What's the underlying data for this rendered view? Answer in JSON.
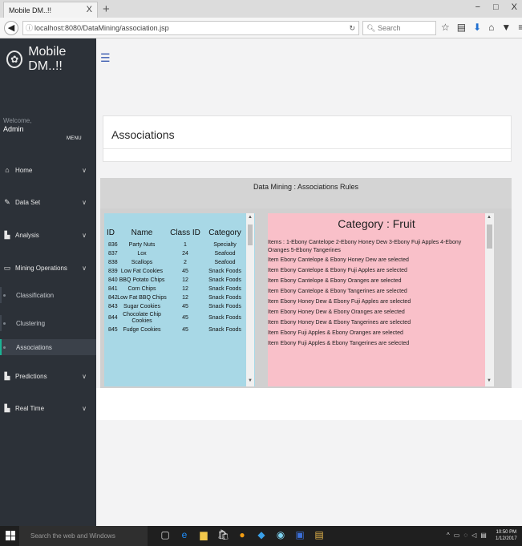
{
  "browser": {
    "tab_title": "Mobile DM..!!",
    "tab_close": "X",
    "new_tab": "+",
    "window_controls": [
      "−",
      "□",
      "X"
    ],
    "url": "localhost:8080/DataMining/association.jsp",
    "search_placeholder": "Search",
    "toolbar_icons": [
      "star-icon",
      "reader-icon",
      "download-icon",
      "home-icon",
      "pocket-icon",
      "menu-icon"
    ]
  },
  "sidebar": {
    "brand": "Mobile DM..!!",
    "welcome": "Welcome,",
    "user": "Admin",
    "menu_label": "MENU",
    "items": [
      {
        "label": "Home",
        "icon": "home-icon"
      },
      {
        "label": "Data Set",
        "icon": "edit-icon"
      },
      {
        "label": "Analysis",
        "icon": "chart-icon"
      },
      {
        "label": "Mining Operations",
        "icon": "monitor-icon"
      },
      {
        "label": "Predictions",
        "icon": "chart-icon"
      },
      {
        "label": "Real Time",
        "icon": "chart-icon"
      }
    ],
    "sub_items": [
      {
        "label": "Classification"
      },
      {
        "label": "Clustering"
      },
      {
        "label": "Associations",
        "active": true
      }
    ]
  },
  "main": {
    "page_title": "Associations",
    "rules_title": "Data Mining : Associations Rules",
    "products": {
      "headers": [
        "ID",
        "Name",
        "Class ID",
        "Category"
      ],
      "rows": [
        [
          "836",
          "Party Nuts",
          "1",
          "Specialty"
        ],
        [
          "837",
          "Lox",
          "24",
          "Seafood"
        ],
        [
          "838",
          "Scallops",
          "2",
          "Seafood"
        ],
        [
          "839",
          "Low Fat Cookies",
          "45",
          "Snack Foods"
        ],
        [
          "840",
          "BBQ Potato Chips",
          "12",
          "Snack Foods"
        ],
        [
          "841",
          "Corn Chips",
          "12",
          "Snack Foods"
        ],
        [
          "842",
          "Low Fat BBQ Chips",
          "12",
          "Snack Foods"
        ],
        [
          "843",
          "Sugar Cookies",
          "45",
          "Snack Foods"
        ],
        [
          "844",
          "Chocolate Chip Cookies",
          "45",
          "Snack Foods"
        ],
        [
          "845",
          "Fudge Cookies",
          "45",
          "Snack Foods"
        ]
      ]
    },
    "category": {
      "title": "Category : Fruit",
      "items_line": "Items : 1-Ebony Cantelope 2-Ebony Honey Dew 3-Ebony Fuji Apples 4-Ebony Oranges 5-Ebony Tangerines",
      "rules": [
        "Item Ebony Cantelope & Ebony Honey Dew are selected",
        "Item Ebony Cantelope & Ebony Fuji Apples are selected",
        "Item Ebony Cantelope & Ebony Oranges are selected",
        "Item Ebony Cantelope & Ebony Tangerines are selected",
        "Item Ebony Honey Dew & Ebony Fuji Apples are selected",
        "Item Ebony Honey Dew & Ebony Oranges are selected",
        "Item Ebony Honey Dew & Ebony Tangerines are selected",
        "Item Ebony Fuji Apples & Ebony Oranges are selected",
        "Item Ebony Fuji Apples & Ebony Tangerines are selected"
      ]
    }
  },
  "taskbar": {
    "search_text": "Search the web and Windows",
    "time": "10:50 PM",
    "date": "1/12/2017"
  },
  "colors": {
    "sidebar_bg": "#2c3138",
    "active_accent": "#1ab394",
    "products_bg": "#a8d8e6",
    "category_bg": "#f9c0c9"
  }
}
